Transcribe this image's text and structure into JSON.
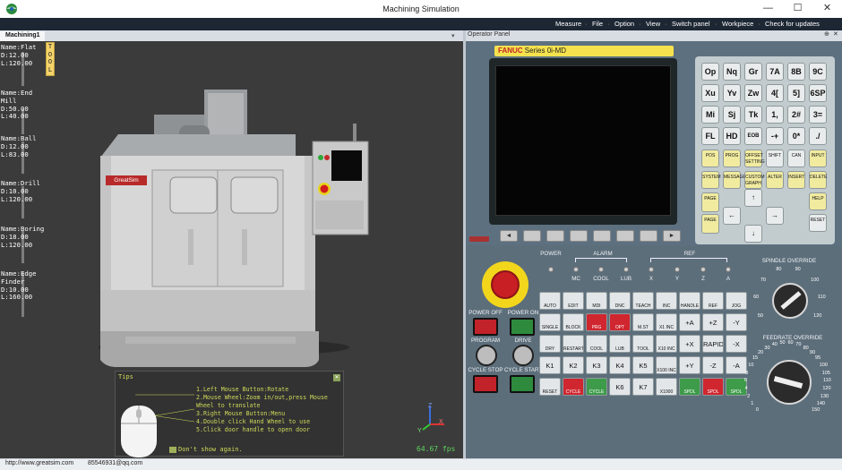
{
  "app": {
    "title": "Machining Simulation",
    "window_controls": [
      "—",
      "☐",
      "✕"
    ]
  },
  "menu": [
    "Measure",
    "File",
    "Option",
    "View",
    "Switch panel",
    "Workpiece",
    "Check for updates"
  ],
  "document_tab": "Machining1",
  "tool_badge": "T\nO\nO\nL",
  "tools": [
    {
      "text": "Name:Flat\nD:12.00\nL:120.00"
    },
    {
      "text": "Name:End\nMill\nD:50.00\nL:40.00"
    },
    {
      "text": "Name:Ball\nD:12.00\nL:83.00"
    },
    {
      "text": "Name:Drill\nD:10.00\nL:120.00"
    },
    {
      "text": "Name:Boring\nD:18.00\nL:120.00"
    },
    {
      "text": "Name:Edge\nFinder\nD:10.00\nL:160.00"
    }
  ],
  "machine_brand": "GreatSim",
  "tips": {
    "title": "Tips",
    "lines": [
      "1.Left Mouse Button:Rotate",
      "2.Mouse Wheel:Zoom in/out,press Mouse",
      "Wheel to translate",
      "3.Right Mouse Button:Menu",
      "4.Double click Hand Wheel to use",
      "5.Click door handle to open door"
    ],
    "dont_show": "Don't show again."
  },
  "axis_labels": {
    "x": "X",
    "y": "Y",
    "z": "Z"
  },
  "fps": "64.67 fps",
  "status": {
    "url": "http://www.greatsim.com",
    "qq": "85546931@qq.com"
  },
  "operator_panel": {
    "header": "Operator Panel",
    "header_icons": [
      "⊕",
      "✕"
    ],
    "controller": {
      "brand": "FANUC",
      "series": "Series 0i-MD"
    },
    "softkeys": [
      "◄",
      "",
      "",
      "",
      "",
      "",
      "",
      "►"
    ],
    "keypad": [
      [
        "Op",
        "Nq",
        "Gr",
        "7A",
        "8B",
        "9C"
      ],
      [
        "Xu",
        "Yv",
        "Zw",
        "4[",
        "5]",
        "6SP"
      ],
      [
        "Mi",
        "Sj",
        "Tk",
        "1,",
        "2#",
        "3="
      ],
      [
        "FL",
        "HD",
        "EOB",
        "-+",
        "0*",
        "./"
      ]
    ],
    "fn_keys_row1": [
      "POS",
      "PROG",
      "OFFSET SETTING",
      "SHIFT",
      "CAN",
      "INPUT"
    ],
    "fn_keys_row2": [
      "SYSTEM",
      "MESSAGE",
      "CUSTOM GRAPH",
      "ALTER",
      "INSERT",
      "DELETE"
    ],
    "page_up": "PAGE",
    "page_down": "PAGE",
    "help": "HELP",
    "reset": "RESET",
    "labels": {
      "power": "POWER",
      "alarm": "ALARM",
      "ref": "REF",
      "alarm_items": [
        "MC",
        "COOL",
        "LUB"
      ],
      "ref_items": [
        "X",
        "Y",
        "Z",
        "A"
      ],
      "power_off": "POWER OFF",
      "power_on": "POWER ON",
      "program": "PROGRAM",
      "drive": "DRIVE",
      "cycle_stop": "CYCLE STOP",
      "cycle_start": "CYCLE START",
      "spindle_override": "SPINDLE OVERRIDE",
      "feedrate_override": "FEEDRATE OVERRIDE"
    },
    "mode_buttons": [
      [
        "AUTO",
        "EDIT",
        "MDI",
        "DNC",
        "TEACH",
        "INC",
        "HANDLE",
        "REF",
        "JOG"
      ],
      [
        "SINGLE BLOCK",
        "BLOCK SKIP",
        "PRG STOP",
        "OPT STOP",
        "M.ST LOCK",
        "X1 INC",
        "+A",
        "+Z",
        "-Y"
      ],
      [
        "DRY RUN",
        "RESTART",
        "COOL",
        "LUB",
        "TOOL",
        "X10 INC",
        "+X",
        "RAPID",
        "-X"
      ],
      [
        "K1",
        "K2",
        "K3",
        "K4",
        "K5",
        "X100 INC",
        "+Y",
        "-Z",
        "-A"
      ],
      [
        "RESET",
        "CYCLE STOP",
        "CYCLE START",
        "K6",
        "K7",
        "X1000 INC",
        "SPDL CW",
        "SPDL STOP",
        "SPDL CCW"
      ]
    ],
    "spindle_ticks": [
      "50",
      "60",
      "70",
      "80",
      "90",
      "100",
      "110",
      "120"
    ],
    "feed_ticks": [
      "0",
      "1",
      "2",
      "4",
      "6",
      "8",
      "10",
      "15",
      "20",
      "30",
      "40",
      "50",
      "60",
      "70",
      "80",
      "90",
      "95",
      "100",
      "105",
      "110",
      "120",
      "130",
      "140",
      "150"
    ]
  }
}
